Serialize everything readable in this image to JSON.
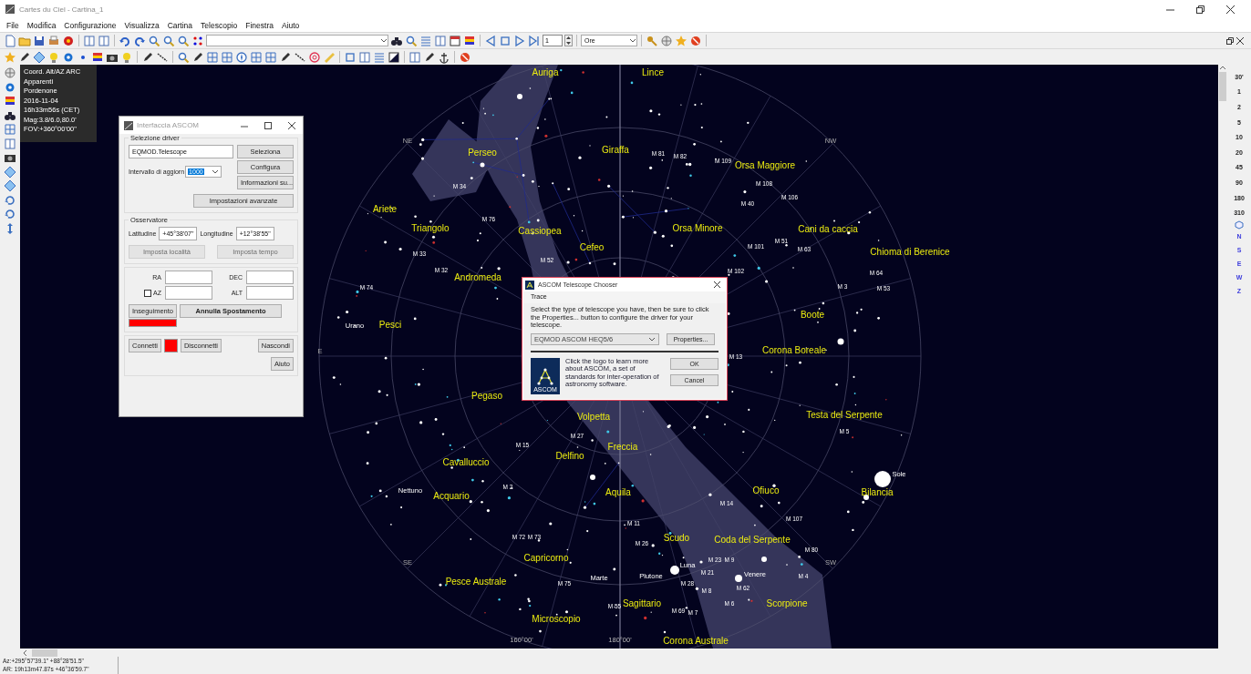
{
  "window": {
    "title": "Cartes du Ciel - Cartina_1"
  },
  "menu": [
    "File",
    "Modifica",
    "Configurazione",
    "Visualizza",
    "Cartina",
    "Telescopio",
    "Finestra",
    "Aiuto"
  ],
  "toolbar": {
    "step_value": "1",
    "time_unit": "Ore"
  },
  "info_overlay": [
    "Coord. Alt/AZ ARC",
    "Apparenti",
    "Pordenone",
    "2016-11-04",
    "16h33m56s (CET)",
    "Mag:3.8/6.0,80.0'",
    "FOV:+360°00'00\""
  ],
  "sky_map": {
    "labels": [
      {
        "text": "Auriga",
        "kind": "constellation"
      },
      {
        "text": "Lince",
        "kind": "constellation"
      },
      {
        "text": "NE",
        "kind": "compass"
      },
      {
        "text": "NW",
        "kind": "compass"
      },
      {
        "text": "Perseo",
        "kind": "constellation"
      },
      {
        "text": "Giraffa",
        "kind": "constellation"
      },
      {
        "text": "M 81",
        "kind": "messier"
      },
      {
        "text": "M 82",
        "kind": "messier"
      },
      {
        "text": "M 109",
        "kind": "messier"
      },
      {
        "text": "Orsa Maggiore",
        "kind": "constellation"
      },
      {
        "text": "M 34",
        "kind": "messier"
      },
      {
        "text": "M 108",
        "kind": "messier"
      },
      {
        "text": "M 40",
        "kind": "messier"
      },
      {
        "text": "M 106",
        "kind": "messier"
      },
      {
        "text": "Ariete",
        "kind": "constellation"
      },
      {
        "text": "M 76",
        "kind": "messier"
      },
      {
        "text": "Triangolo",
        "kind": "constellation"
      },
      {
        "text": "Cassiopea",
        "kind": "constellation"
      },
      {
        "text": "Orsa Minore",
        "kind": "constellation"
      },
      {
        "text": "Cani da caccia",
        "kind": "constellation"
      },
      {
        "text": "Cefeo",
        "kind": "constellation"
      },
      {
        "text": "M 101",
        "kind": "messier"
      },
      {
        "text": "M 51",
        "kind": "messier"
      },
      {
        "text": "M 63",
        "kind": "messier"
      },
      {
        "text": "M 33",
        "kind": "messier"
      },
      {
        "text": "Chioma di Berenice",
        "kind": "constellation"
      },
      {
        "text": "M 52",
        "kind": "messier"
      },
      {
        "text": "M 32",
        "kind": "messier"
      },
      {
        "text": "Andromeda",
        "kind": "constellation"
      },
      {
        "text": "M 102",
        "kind": "messier"
      },
      {
        "text": "M 64",
        "kind": "messier"
      },
      {
        "text": "M 74",
        "kind": "messier"
      },
      {
        "text": "M 3",
        "kind": "messier"
      },
      {
        "text": "M 53",
        "kind": "messier"
      },
      {
        "text": "Boote",
        "kind": "constellation"
      },
      {
        "text": "Urano",
        "kind": "object"
      },
      {
        "text": "Pesci",
        "kind": "constellation"
      },
      {
        "text": "E",
        "kind": "compass"
      },
      {
        "text": "M 13",
        "kind": "messier"
      },
      {
        "text": "Corona Boreale",
        "kind": "constellation"
      },
      {
        "text": "Pegaso",
        "kind": "constellation"
      },
      {
        "text": "Volpetta",
        "kind": "constellation"
      },
      {
        "text": "Testa del Serpente",
        "kind": "constellation"
      },
      {
        "text": "M 27",
        "kind": "messier"
      },
      {
        "text": "M 5",
        "kind": "messier"
      },
      {
        "text": "M 15",
        "kind": "messier"
      },
      {
        "text": "Freccia",
        "kind": "constellation"
      },
      {
        "text": "Cavalluccio",
        "kind": "constellation"
      },
      {
        "text": "Delfino",
        "kind": "constellation"
      },
      {
        "text": "Sole",
        "kind": "object"
      },
      {
        "text": "Nettuno",
        "kind": "object"
      },
      {
        "text": "Acquario",
        "kind": "constellation"
      },
      {
        "text": "M 2",
        "kind": "messier"
      },
      {
        "text": "Aquila",
        "kind": "constellation"
      },
      {
        "text": "Ofiuco",
        "kind": "constellation"
      },
      {
        "text": "Bilancia",
        "kind": "constellation"
      },
      {
        "text": "M 14",
        "kind": "messier"
      },
      {
        "text": "M 107",
        "kind": "messier"
      },
      {
        "text": "M 11",
        "kind": "messier"
      },
      {
        "text": "M 72",
        "kind": "messier"
      },
      {
        "text": "M 73",
        "kind": "messier"
      },
      {
        "text": "M 26",
        "kind": "messier"
      },
      {
        "text": "Scudo",
        "kind": "constellation"
      },
      {
        "text": "Coda del Serpente",
        "kind": "constellation"
      },
      {
        "text": "M 80",
        "kind": "messier"
      },
      {
        "text": "SE",
        "kind": "compass"
      },
      {
        "text": "Capricorno",
        "kind": "constellation"
      },
      {
        "text": "Luna",
        "kind": "object"
      },
      {
        "text": "M 23",
        "kind": "messier"
      },
      {
        "text": "M 9",
        "kind": "messier"
      },
      {
        "text": "SW",
        "kind": "compass"
      },
      {
        "text": "Marte",
        "kind": "object"
      },
      {
        "text": "Plutone",
        "kind": "object"
      },
      {
        "text": "M 21",
        "kind": "messier"
      },
      {
        "text": "Venere",
        "kind": "object"
      },
      {
        "text": "M 4",
        "kind": "messier"
      },
      {
        "text": "Pesce Australe",
        "kind": "constellation"
      },
      {
        "text": "M 75",
        "kind": "messier"
      },
      {
        "text": "M 28",
        "kind": "messier"
      },
      {
        "text": "M 8",
        "kind": "messier"
      },
      {
        "text": "M 62",
        "kind": "messier"
      },
      {
        "text": "M 55",
        "kind": "messier"
      },
      {
        "text": "Sagittario",
        "kind": "constellation"
      },
      {
        "text": "M 6",
        "kind": "messier"
      },
      {
        "text": "Scorpione",
        "kind": "constellation"
      },
      {
        "text": "M 69",
        "kind": "messier"
      },
      {
        "text": "M 7",
        "kind": "messier"
      },
      {
        "text": "Microscopio",
        "kind": "constellation"
      },
      {
        "text": "160°00'",
        "kind": "grid"
      },
      {
        "text": "180°00'",
        "kind": "grid"
      },
      {
        "text": "Corona Australe",
        "kind": "constellation"
      }
    ]
  },
  "zoom_scale": [
    "30'",
    "1",
    "2",
    "5",
    "10",
    "20",
    "45",
    "90",
    "180",
    "310"
  ],
  "direction_buttons": [
    "N",
    "S",
    "E",
    "W",
    "Z"
  ],
  "status_bar": [
    "Az:+295°57'39.1\" +88°28'51.5\"",
    "AR: 19h13m47.87s +46°36'59.7\""
  ],
  "ascom_dialog": {
    "title": "Interfaccia ASCOM",
    "driver_group": {
      "title": "Selezione driver",
      "driver": "EQMOD.Telescope",
      "buttons": [
        "Seleziona",
        "Configura",
        "Informazioni su..."
      ],
      "interval_label": "Intervallo di aggiorn",
      "interval_value": "1000",
      "advanced_button": "Impostazioni avanzate"
    },
    "observer_group": {
      "title": "Osservatore",
      "latitude_label": "Latitudine",
      "latitude": "+45°38'07\"",
      "longitude_label": "Longitudine",
      "longitude": "+12°38'55\"",
      "buttons": [
        {
          "label": "Imposta località",
          "disabled": true
        },
        {
          "label": "Imposta tempo",
          "disabled": true
        }
      ]
    },
    "coords": {
      "ra_label": "RA",
      "dec_label": "DEC",
      "az_label": "AZ",
      "az_checked": false,
      "alt_label": "ALT",
      "tracking_button": "Inseguimento",
      "tracking_on": false,
      "abort_button": "Annulla Spostamento"
    },
    "footer": {
      "connect": "Connetti",
      "connected": false,
      "disconnect": "Disconnetti",
      "hide": "Nascondi",
      "help": "Aiuto"
    }
  },
  "chooser_dialog": {
    "title": "ASCOM Telescope Chooser",
    "menu": "Trace",
    "instructions": "Select the type of telescope you have, then be sure to click the Properties... button to configure the driver for your telescope.",
    "driver": "EQMOD ASCOM HEQ5/6",
    "properties_button": "Properties...",
    "logo_text": "ASCOM",
    "about": "Click the logo to learn more about ASCOM, a set of standards for inter-operation of astronomy software.",
    "buttons": [
      "OK",
      "Cancel"
    ]
  }
}
